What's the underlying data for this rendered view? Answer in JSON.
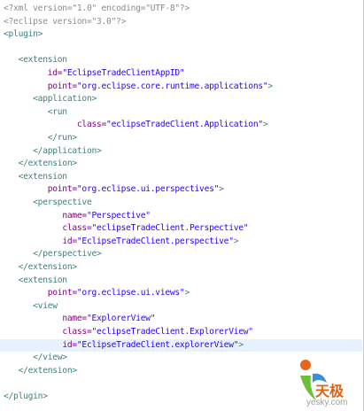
{
  "editor": {
    "lines": [
      {
        "indent": "",
        "parts": [
          {
            "c": "p",
            "t": "<?xml version=\"1.0\" encoding=\"UTF-8\"?>"
          }
        ]
      },
      {
        "indent": "",
        "parts": [
          {
            "c": "p",
            "t": "<?eclipse version=\"3.0\"?>"
          }
        ]
      },
      {
        "indent": "",
        "parts": [
          {
            "c": "t",
            "t": "<plugin>"
          }
        ]
      },
      {
        "indent": "",
        "parts": []
      },
      {
        "indent": "   ",
        "parts": [
          {
            "c": "t",
            "t": "<extension"
          }
        ]
      },
      {
        "indent": "         ",
        "parts": [
          {
            "c": "a",
            "t": "id="
          },
          {
            "c": "s",
            "t": "\"EclipseTradeClientAppID\""
          }
        ]
      },
      {
        "indent": "         ",
        "parts": [
          {
            "c": "a",
            "t": "point="
          },
          {
            "c": "s",
            "t": "\"org.eclipse.core.runtime.applications\""
          },
          {
            "c": "t",
            "t": ">"
          }
        ]
      },
      {
        "indent": "      ",
        "parts": [
          {
            "c": "t",
            "t": "<application>"
          }
        ]
      },
      {
        "indent": "         ",
        "parts": [
          {
            "c": "t",
            "t": "<run"
          }
        ]
      },
      {
        "indent": "               ",
        "parts": [
          {
            "c": "a",
            "t": "class="
          },
          {
            "c": "s",
            "t": "\"eclipseTradeClient.Application\""
          },
          {
            "c": "t",
            "t": ">"
          }
        ]
      },
      {
        "indent": "         ",
        "parts": [
          {
            "c": "t",
            "t": "</run>"
          }
        ]
      },
      {
        "indent": "      ",
        "parts": [
          {
            "c": "t",
            "t": "</application>"
          }
        ]
      },
      {
        "indent": "   ",
        "parts": [
          {
            "c": "t",
            "t": "</extension>"
          }
        ]
      },
      {
        "indent": "   ",
        "parts": [
          {
            "c": "t",
            "t": "<extension"
          }
        ]
      },
      {
        "indent": "         ",
        "parts": [
          {
            "c": "a",
            "t": "point="
          },
          {
            "c": "s",
            "t": "\"org.eclipse.ui.perspectives\""
          },
          {
            "c": "t",
            "t": ">"
          }
        ]
      },
      {
        "indent": "      ",
        "parts": [
          {
            "c": "t",
            "t": "<perspective"
          }
        ]
      },
      {
        "indent": "            ",
        "parts": [
          {
            "c": "a",
            "t": "name="
          },
          {
            "c": "s",
            "t": "\"Perspective\""
          }
        ]
      },
      {
        "indent": "            ",
        "parts": [
          {
            "c": "a",
            "t": "class="
          },
          {
            "c": "s",
            "t": "\"eclipseTradeClient.Perspective\""
          }
        ]
      },
      {
        "indent": "            ",
        "parts": [
          {
            "c": "a",
            "t": "id="
          },
          {
            "c": "s",
            "t": "\"EclipseTradeClient.perspective\""
          },
          {
            "c": "t",
            "t": ">"
          }
        ]
      },
      {
        "indent": "      ",
        "parts": [
          {
            "c": "t",
            "t": "</perspective>"
          }
        ]
      },
      {
        "indent": "   ",
        "parts": [
          {
            "c": "t",
            "t": "</extension>"
          }
        ]
      },
      {
        "indent": "   ",
        "parts": [
          {
            "c": "t",
            "t": "<extension"
          }
        ]
      },
      {
        "indent": "         ",
        "parts": [
          {
            "c": "a",
            "t": "point="
          },
          {
            "c": "s",
            "t": "\"org.eclipse.ui.views\""
          },
          {
            "c": "t",
            "t": ">"
          }
        ]
      },
      {
        "indent": "      ",
        "parts": [
          {
            "c": "t",
            "t": "<view"
          }
        ]
      },
      {
        "indent": "            ",
        "parts": [
          {
            "c": "a",
            "t": "name="
          },
          {
            "c": "s",
            "t": "\"ExplorerView\""
          }
        ]
      },
      {
        "indent": "            ",
        "parts": [
          {
            "c": "a",
            "t": "class="
          },
          {
            "c": "s",
            "t": "\"eclipseTradeClient.ExplorerView\""
          }
        ]
      },
      {
        "indent": "            ",
        "highlight": true,
        "parts": [
          {
            "c": "a",
            "t": "id="
          },
          {
            "c": "s",
            "t": "\"EclipseTradeClient.explorerView\""
          },
          {
            "c": "t",
            "t": ">"
          }
        ]
      },
      {
        "indent": "      ",
        "parts": [
          {
            "c": "t",
            "t": "</view>"
          }
        ]
      },
      {
        "indent": "   ",
        "parts": [
          {
            "c": "t",
            "t": "</extension>"
          }
        ]
      },
      {
        "indent": "",
        "parts": []
      },
      {
        "indent": "",
        "parts": [
          {
            "c": "t",
            "t": "</plugin>"
          }
        ]
      }
    ]
  },
  "watermark": {
    "brand": "天极",
    "domain": "yesky.com",
    "colors": {
      "orange": "#e8661a",
      "green": "#6cbf3a",
      "blue": "#3a8fd8"
    }
  }
}
